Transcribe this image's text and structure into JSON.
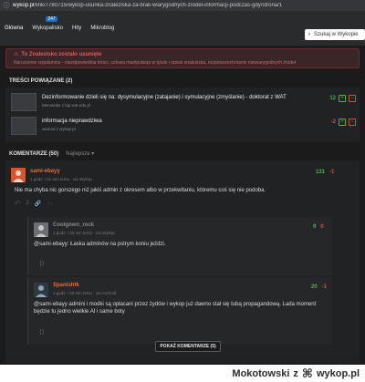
{
  "browser": {
    "url_domain": "wykop.pl",
    "url_path": "/link/7780715/wykop-usunka-znaleziska-za-brak-wiarygodnych-zrodel-informacji-podczas-gdy/strona/1"
  },
  "nav": {
    "items": [
      "Główna",
      "Wykopalisko",
      "Hity",
      "Mikroblog"
    ],
    "wykopalisko_badge": "247",
    "search_placeholder": "Szukaj w Wykopie"
  },
  "alert": {
    "title": "To Znalezisko zostało usunięte",
    "reason": "Naruszenie regulaminu - niezdpowiednia treści, celowa manipulacja w tytule i opisie znaleziska, rozpowszechnianie niewiarygodnych źródeł"
  },
  "related": {
    "title": "TREŚCI POWIĄZANE (2)",
    "items": [
      {
        "title": "Dezinformowanie dzieli się na: dysymulacyjne (zatajanie) i symulacyjne (zmyślanie) - doktorat z WAT",
        "source": "Memwake z bip.wat.edu.pl",
        "votes": "12"
      },
      {
        "title": "informacja nieprawdziwa",
        "source": "wanted z wykop.pl",
        "votes": "-2"
      }
    ]
  },
  "comments": {
    "title": "KOMENTARZE (50)",
    "sort_label": "Najlepsze ▾",
    "list": [
      {
        "user": "sami-ebayy",
        "meta": "1 godz. i 41 min temu · via Wykop",
        "text": "Nie ma chyba nic gorszego niż jakiś admin z okresem albo w przekwitaniu, któremu coś się nie podoba.",
        "plus": "131",
        "minus": "-1",
        "extra": "2"
      },
      {
        "user": "Coolgown_rock",
        "meta": "1 godz. i 33 min temu · via Wykop",
        "text": "@sami-ebayy: Łaska adminów na pstrym koniu jeździ.",
        "plus": "9",
        "minus": "0"
      },
      {
        "user": "Spanishtk",
        "meta": "1 godz. i 33 min temu · via Android",
        "text": "@sami-ebayy admini i modki są opłacani przez żydów i wykop już dawno stał się tubą propagandową. Lada moment będzie tu jedno wielkie AI i same boty",
        "plus": "20",
        "minus": "-1"
      }
    ],
    "more_button": "POKAŻ KOMENTARZE (5)"
  },
  "watermark": {
    "user": "Mokotowski",
    "sep": "z",
    "site": "wykop.pl"
  }
}
